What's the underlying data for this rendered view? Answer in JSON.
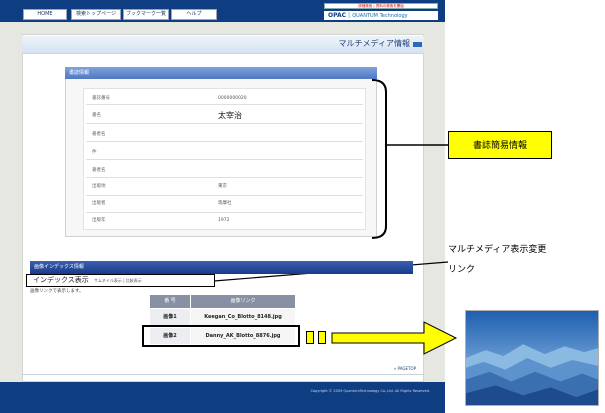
{
  "nav": {
    "items": [
      "HOME",
      "検索トップページ",
      "ブックマーク一覧",
      "ヘルプ"
    ]
  },
  "header": {
    "search_text": "詳細検索 | 資料の検索を開始",
    "logo": "OPAC",
    "logo_sub": "QUANTUM Technology"
  },
  "page": {
    "title": "マルチメディア情報"
  },
  "biblio": {
    "header": "書誌情報",
    "rows": [
      {
        "label": "書誌番号",
        "value": "0000000020"
      },
      {
        "label": "書名",
        "value": "太宰治"
      },
      {
        "label": "著者名",
        "value": ""
      },
      {
        "label": "件",
        "value": ""
      },
      {
        "label": "著者名",
        "value": ""
      },
      {
        "label": "出版地",
        "value": "東京"
      },
      {
        "label": "出版者",
        "value": "筑摩社"
      },
      {
        "label": "出版年",
        "value": "1972"
      }
    ]
  },
  "callouts": {
    "biblio": "書誌簡易情報",
    "multimedia_line1": "マルチメディア表示変更",
    "multimedia_line2": "リンク"
  },
  "index": {
    "header": "画像インデックス情報",
    "tab_index": "インデックス表示",
    "tab_thumb": "サムネイル表示 | 比較表示",
    "note": "画像リンクで表示します。",
    "columns": [
      "番 号",
      "画像リンク"
    ],
    "rows": [
      {
        "no": "画像1",
        "link": "Keegan_Co_Blotto_8148.jpg"
      },
      {
        "no": "画像2",
        "link": "Danny_AK_Blotto_8876.jpg"
      }
    ]
  },
  "footer": {
    "pagetop": "» PAGETOP",
    "copyright": "Copyright © 2009 QuantumTechnology Co.,Ltd. All Rights Reserved."
  },
  "colors": {
    "nav_blue": "#0e3d82",
    "callout_yellow": "#ffff00"
  }
}
